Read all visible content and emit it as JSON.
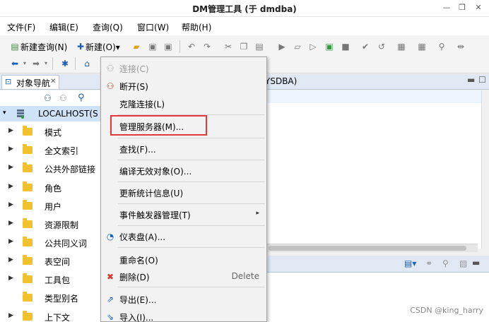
{
  "window": {
    "title": "DM管理工具 (于 dmdba)"
  },
  "menubar": [
    "文件(F)",
    "编辑(E)",
    "查询(Q)",
    "窗口(W)",
    "帮助(H)"
  ],
  "toolbar": {
    "new_query": "新建查询(N)",
    "new": "新建(O)▾"
  },
  "navigator": {
    "tab_label": "对象导航",
    "root_label": "LOCALHOST(S",
    "items": [
      "模式",
      "全文索引",
      "公共外部链接",
      "角色",
      "用户",
      "资源限制",
      "公共同义词",
      "表空间",
      "工具包",
      "类型别名",
      "上下文"
    ]
  },
  "editor": {
    "tab_label": "YSDBA)"
  },
  "context_menu": {
    "items": [
      {
        "label": "连接(C)",
        "icon": "connect-icon",
        "disabled": true
      },
      {
        "label": "断开(S)",
        "icon": "disconnect-icon"
      },
      {
        "label": "克隆连接(L)"
      },
      {
        "label": "管理服务器(M)..."
      },
      {
        "label": "查找(F)..."
      },
      {
        "label": "编译无效对象(O)..."
      },
      {
        "label": "更新统计信息(U)"
      },
      {
        "label": "事件触发器管理(T)",
        "submenu": "▸"
      },
      {
        "label": "仪表盘(A)...",
        "icon": "dashboard-icon"
      },
      {
        "label": "重命名(O)"
      },
      {
        "label": "删除(D)",
        "icon": "delete-icon",
        "shortcut": "Delete"
      },
      {
        "label": "导出(E)...",
        "icon": "export-icon"
      },
      {
        "label": "导入(I)...",
        "icon": "import-icon"
      }
    ]
  },
  "watermark": "CSDN @king_harry",
  "colors": {
    "highlight_border": "#e03a3a",
    "selection": "#cfe3f8",
    "folder": "#f2c12e"
  }
}
